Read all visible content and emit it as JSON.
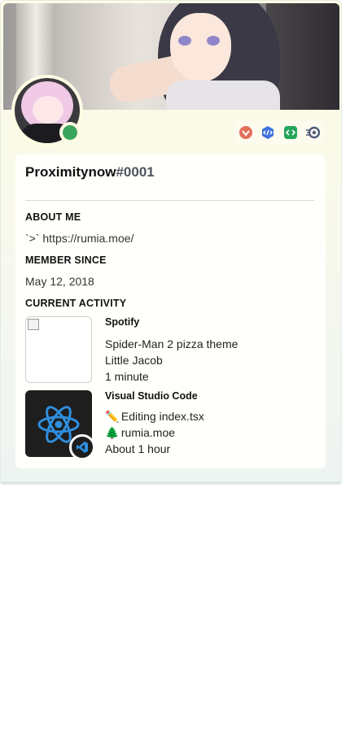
{
  "profile": {
    "username": "Proximitynow",
    "discriminator": "#0001",
    "status": "online"
  },
  "about": {
    "heading": "ABOUT ME",
    "text": "`>` https://rumia.moe/"
  },
  "member_since": {
    "heading": "MEMBER SINCE",
    "date": "May 12, 2018"
  },
  "activity": {
    "heading": "CURRENT ACTIVITY",
    "items": [
      {
        "app": "Spotify",
        "details": "Spider-Man 2 pizza theme",
        "state": "Little Jacob",
        "elapsed": "1 minute"
      },
      {
        "app": "Visual Studio Code",
        "details_icon": "✏️",
        "details": "Editing index.tsx",
        "state_icon": "🌲",
        "state": "rumia.moe",
        "elapsed": "About 1 hour"
      }
    ]
  },
  "badges": [
    "hypesquad-icon",
    "active-developer-icon",
    "code-icon",
    "nitro-icon"
  ],
  "colors": {
    "status_online": "#3ba55c",
    "discriminator": "#4f5660",
    "card_gradient_top": "#fefce3",
    "card_gradient_bottom": "#eef4f2"
  }
}
